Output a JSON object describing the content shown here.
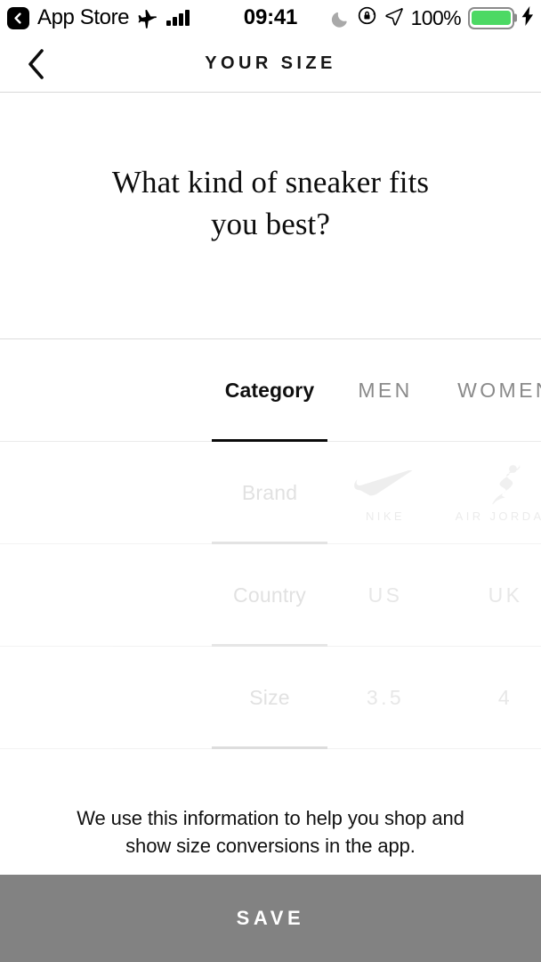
{
  "status_bar": {
    "back_app": "App Store",
    "back_chevron_icon": "chevron-left-icon",
    "airplane_icon": "airplane-mode-icon",
    "signal_icon": "cellular-signal-icon",
    "time": "09:41",
    "moon_icon": "do-not-disturb-moon-icon",
    "rotation_lock_icon": "rotation-lock-icon",
    "location_icon": "location-arrow-icon",
    "battery_percent": "100%",
    "battery_icon": "battery-full-icon",
    "charging_icon": "lightning-bolt-icon",
    "battery_color": "#4cd964"
  },
  "navbar": {
    "back_icon": "chevron-left-icon",
    "title": "YOUR SIZE"
  },
  "question": {
    "line1": "What kind of sneaker fits",
    "line2": "you best?"
  },
  "picker": {
    "tabs": [
      {
        "label": "Category",
        "selected": true
      },
      {
        "label": "MEN",
        "selected": false
      },
      {
        "label": "WOMEN",
        "selected": false
      }
    ],
    "rows": [
      {
        "label": "Brand",
        "options": [
          {
            "name": "NIKE",
            "icon": "nike-swoosh-icon"
          },
          {
            "name": "AIR JORDAN",
            "icon": "jumpman-icon"
          }
        ]
      },
      {
        "label": "Country",
        "options": [
          {
            "name": "US",
            "icon": null
          },
          {
            "name": "UK",
            "icon": null
          }
        ]
      },
      {
        "label": "Size",
        "options": [
          {
            "name": "3.5",
            "icon": null
          },
          {
            "name": "4",
            "icon": null
          }
        ]
      }
    ]
  },
  "footer": {
    "note_line1": "We use this information to help you shop and",
    "note_line2": "show size conversions in the app.",
    "save_label": "SAVE",
    "save_bg": "#828282"
  }
}
